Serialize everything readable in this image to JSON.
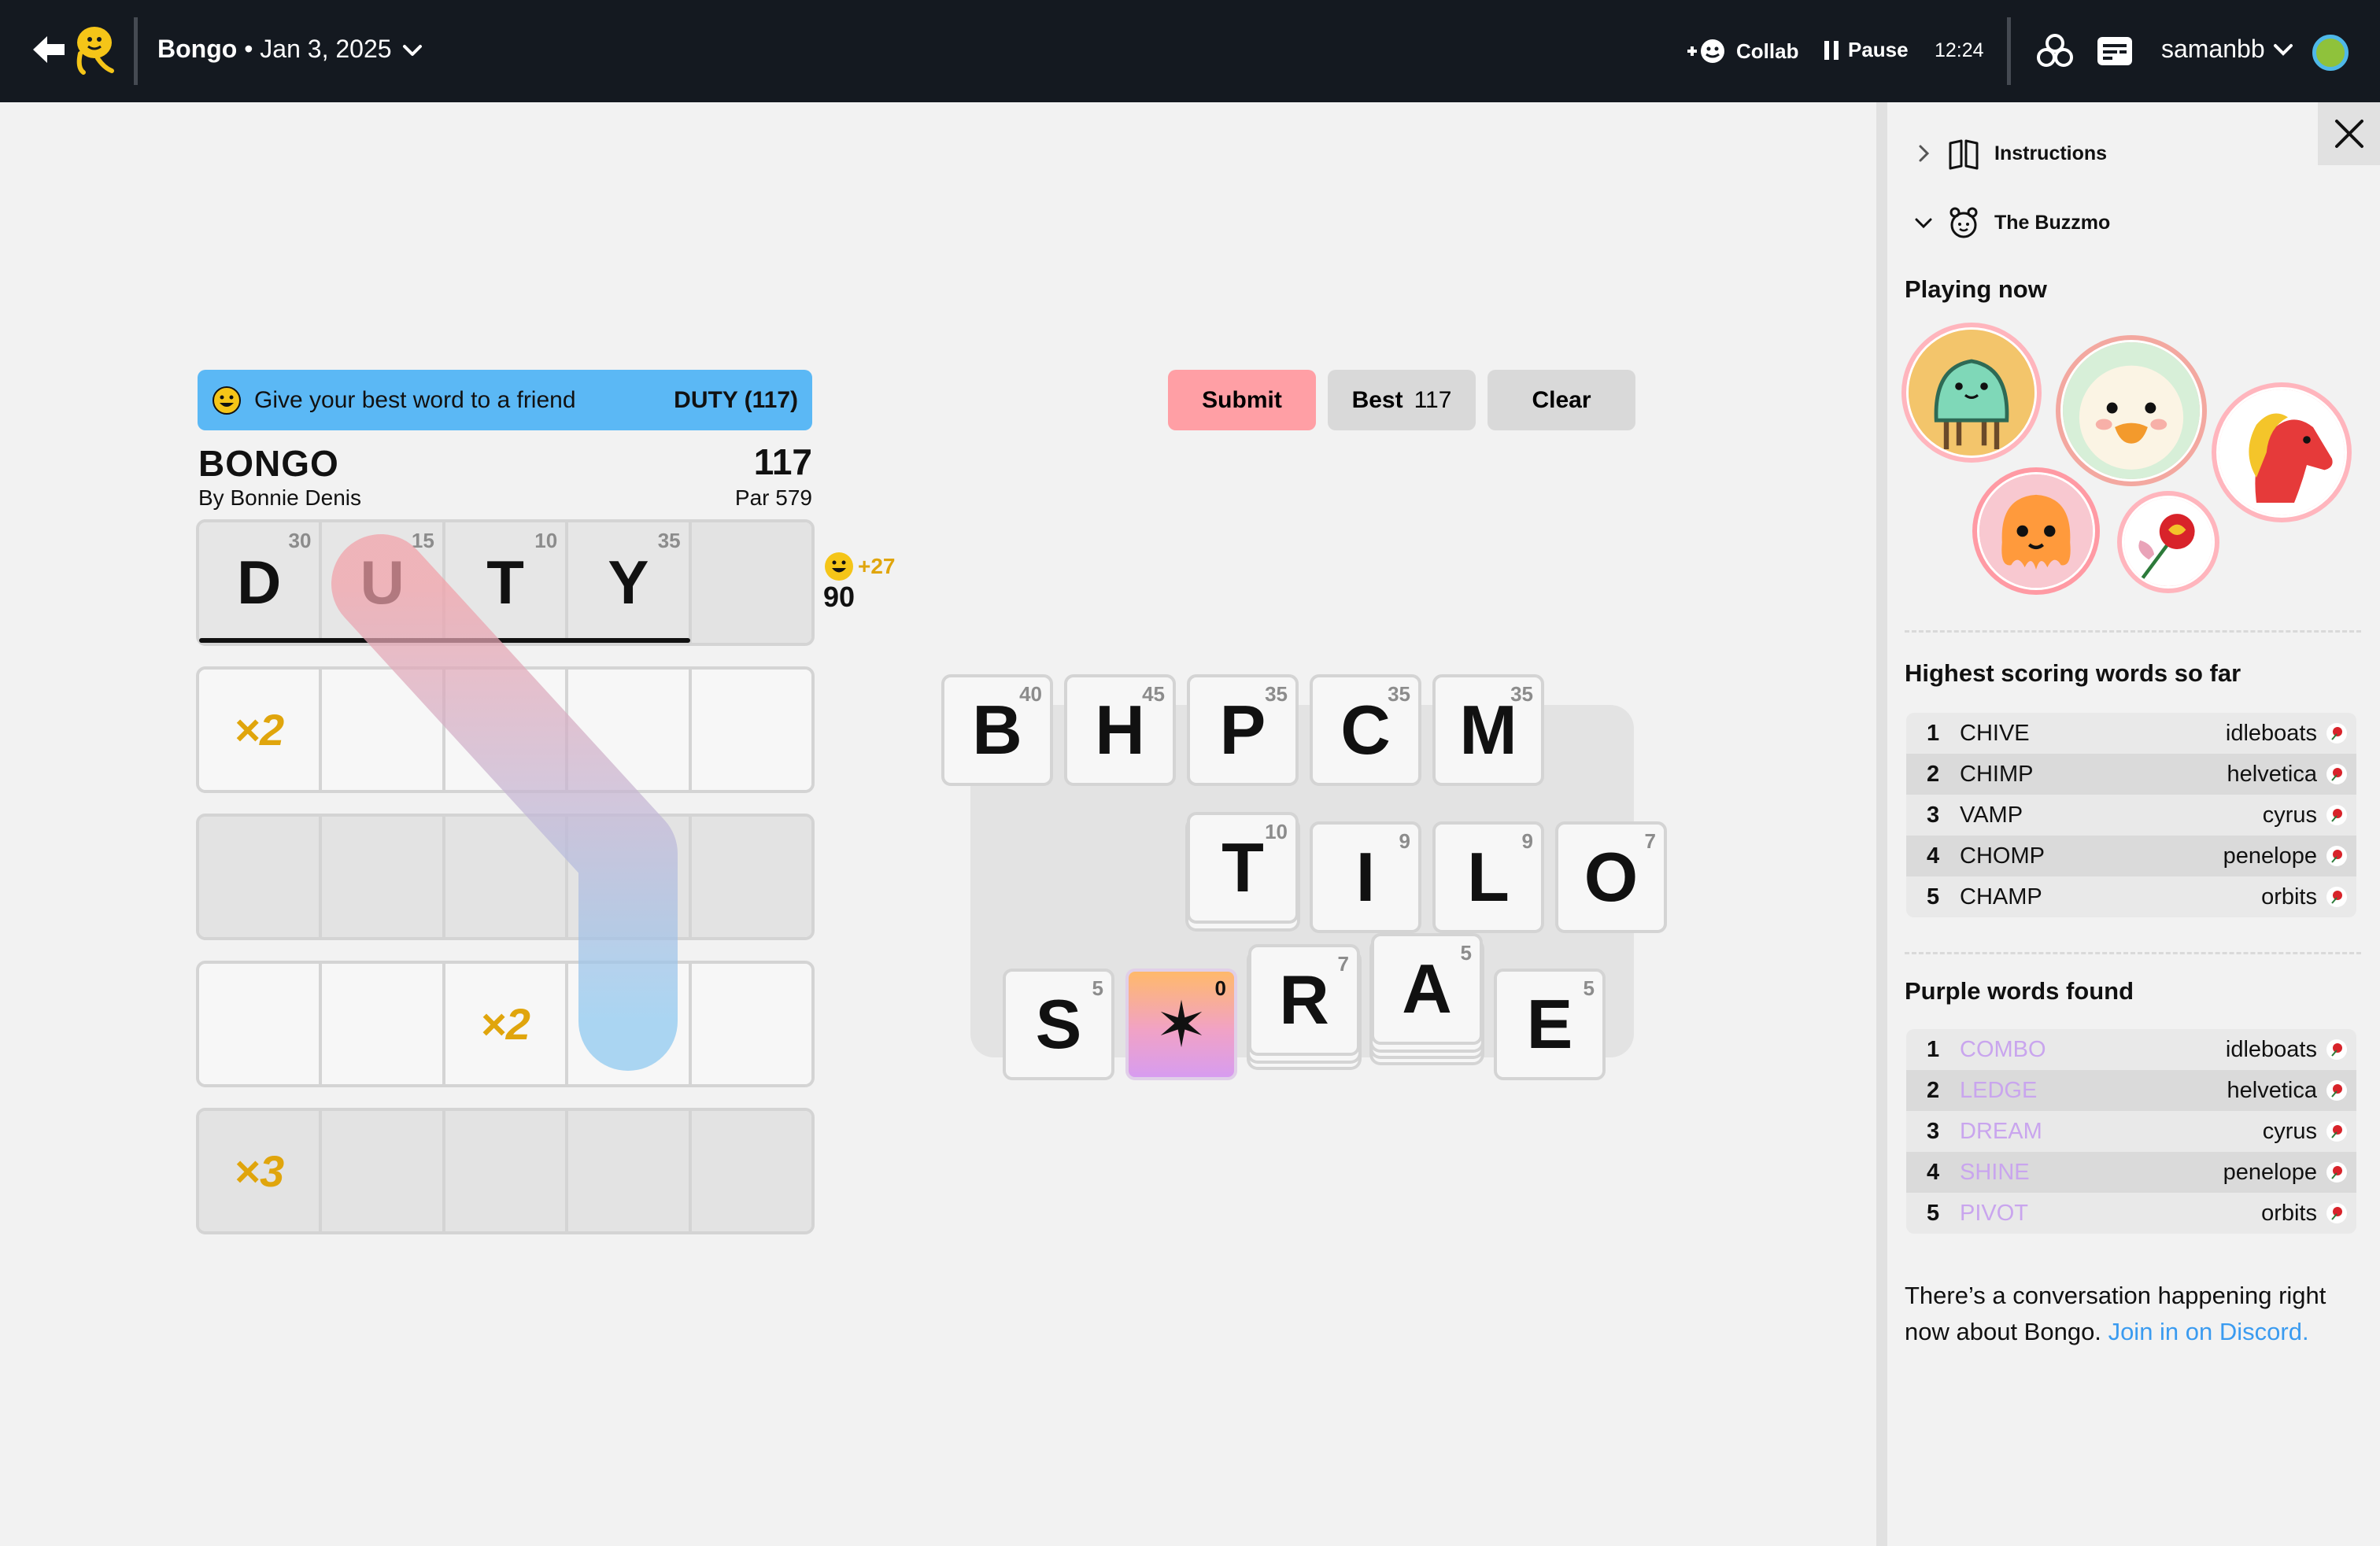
{
  "header": {
    "app_name": "Bongo",
    "separator": "•",
    "date": "Jan 3, 2025",
    "collab_label": "Collab",
    "pause_label": "Pause",
    "timer": "12:24",
    "username": "samanbb",
    "icons": [
      "back-arrow-icon",
      "bongo-mascot-icon",
      "chevron-down-icon",
      "collab-icon",
      "pause-icon",
      "stats-icon",
      "captions-icon",
      "user-avatar-icon"
    ]
  },
  "banner": {
    "message": "Give your best word to a friend",
    "best_word": "DUTY (117)"
  },
  "game": {
    "title": "BONGO",
    "author": "By Bonnie Denis",
    "score": "117",
    "par": "Par 579"
  },
  "board": {
    "row1": {
      "cells": [
        {
          "letter": "D",
          "points": "30"
        },
        {
          "letter": "U",
          "points": "15"
        },
        {
          "letter": "T",
          "points": "10"
        },
        {
          "letter": "Y",
          "points": "35"
        },
        {
          "letter": "",
          "points": ""
        }
      ],
      "bonus": "+27",
      "total": "90"
    },
    "multipliers": {
      "row2_cell1": "×2",
      "row4_cell3": "×2",
      "row5_cell1": "×3"
    }
  },
  "buttons": {
    "submit": "Submit",
    "best_label": "Best",
    "best_value": "117",
    "clear": "Clear"
  },
  "tiles": [
    {
      "letter": "B",
      "points": "40"
    },
    {
      "letter": "H",
      "points": "45"
    },
    {
      "letter": "P",
      "points": "35"
    },
    {
      "letter": "C",
      "points": "35"
    },
    {
      "letter": "M",
      "points": "35"
    },
    {
      "letter": "T",
      "points": "10"
    },
    {
      "letter": "I",
      "points": "9"
    },
    {
      "letter": "L",
      "points": "9"
    },
    {
      "letter": "O",
      "points": "7"
    },
    {
      "letter": "S",
      "points": "5"
    },
    {
      "letter": "✶",
      "points": "0"
    },
    {
      "letter": "R",
      "points": "7"
    },
    {
      "letter": "A",
      "points": "5"
    },
    {
      "letter": "E",
      "points": "5"
    }
  ],
  "sidebar": {
    "instructions": "Instructions",
    "buzzmo": "The Buzzmo",
    "playing_now": "Playing now",
    "highest_title": "Highest scoring words so far",
    "highest": [
      {
        "rank": "1",
        "word": "CHIVE",
        "player": "idleboats"
      },
      {
        "rank": "2",
        "word": "CHIMP",
        "player": "helvetica"
      },
      {
        "rank": "3",
        "word": "VAMP",
        "player": "cyrus"
      },
      {
        "rank": "4",
        "word": "CHOMP",
        "player": "penelope"
      },
      {
        "rank": "5",
        "word": "CHAMP",
        "player": "orbits"
      }
    ],
    "purple_title": "Purple words found",
    "purple": [
      {
        "rank": "1",
        "word": "COMBO",
        "player": "idleboats"
      },
      {
        "rank": "2",
        "word": "LEDGE",
        "player": "helvetica"
      },
      {
        "rank": "3",
        "word": "DREAM",
        "player": "cyrus"
      },
      {
        "rank": "4",
        "word": "SHINE",
        "player": "penelope"
      },
      {
        "rank": "5",
        "word": "PIVOT",
        "player": "orbits"
      }
    ],
    "discord_text": "There’s a conversation happening right now about Bongo.",
    "discord_link": "Join in on Discord."
  },
  "colors": {
    "topbar": "#141920",
    "banner": "#5bb8f5",
    "submit": "#ff9fa5",
    "multiplier": "#e0a50c",
    "purple_word": "#c9a5ee",
    "link": "#3a9bf0"
  }
}
